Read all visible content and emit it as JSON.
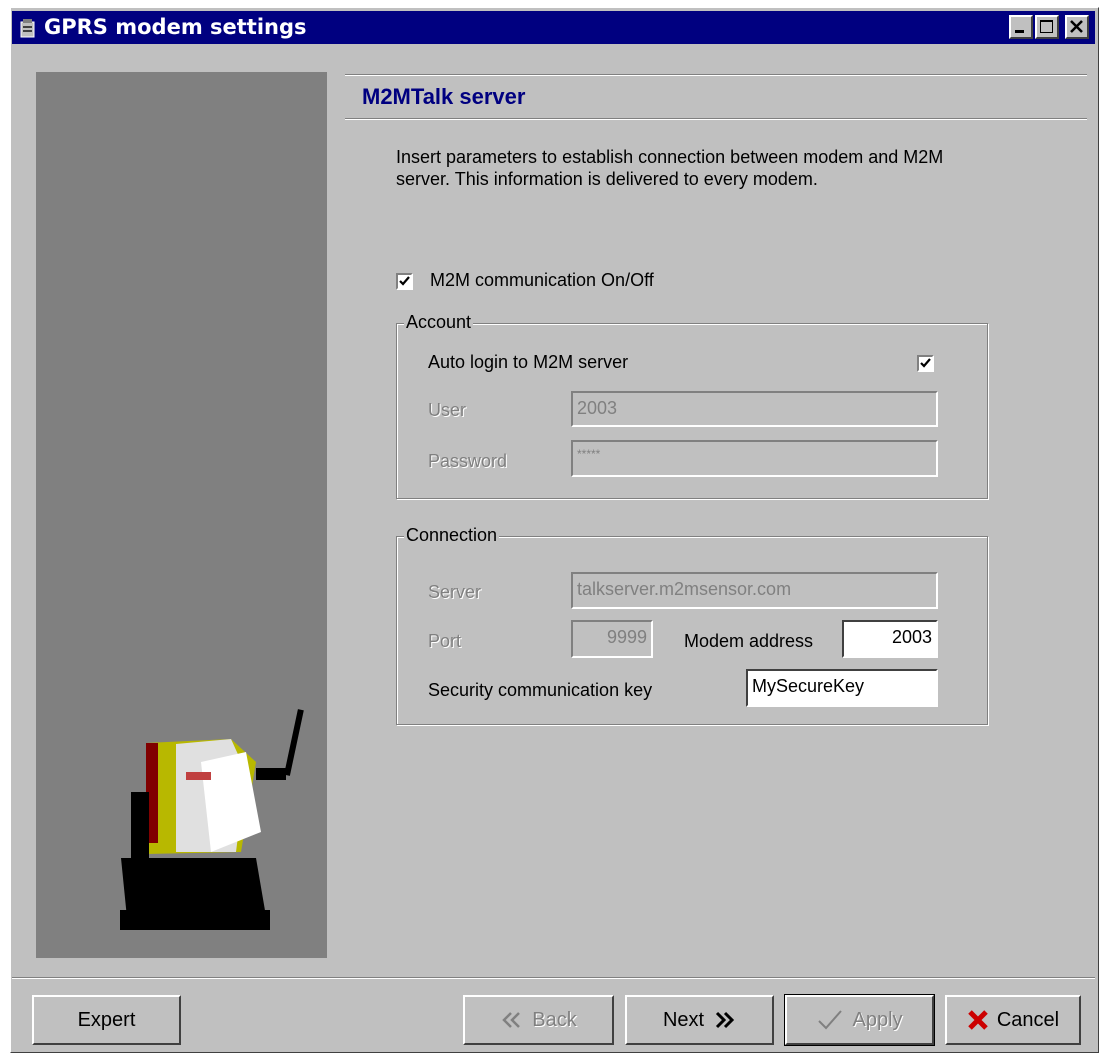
{
  "window": {
    "title": "GPRS modem settings"
  },
  "page": {
    "heading": "M2MTalk server",
    "description": "Insert parameters to establish connection between modem and M2M server. This information is delivered to every modem.",
    "m2m_toggle": {
      "label": "M2M communication On/Off",
      "checked": true
    }
  },
  "account": {
    "legend": "Account",
    "auto_login_label": "Auto login to M2M server",
    "auto_login_checked": true,
    "user_label": "User",
    "user_value": "2003",
    "password_label": "Password",
    "password_value": "*****"
  },
  "connection": {
    "legend": "Connection",
    "server_label": "Server",
    "server_value": "talkserver.m2msensor.com",
    "port_label": "Port",
    "port_value": "9999",
    "modem_address_label": "Modem address",
    "modem_address_value": "2003",
    "security_key_label": "Security communication key",
    "security_key_value": "MySecureKey"
  },
  "buttons": {
    "expert": "Expert",
    "back": "Back",
    "next": "Next",
    "apply": "Apply",
    "cancel": "Cancel"
  },
  "icons": {
    "app": "modem-icon",
    "back": "double-chevron-left-icon",
    "next": "double-chevron-right-icon",
    "apply": "checkmark-icon",
    "cancel": "red-x-icon"
  },
  "colors": {
    "title_bar": "#000080",
    "heading": "#000080",
    "face": "#c0c0c0",
    "side_panel": "#808080",
    "cancel_x": "#cc0000"
  }
}
